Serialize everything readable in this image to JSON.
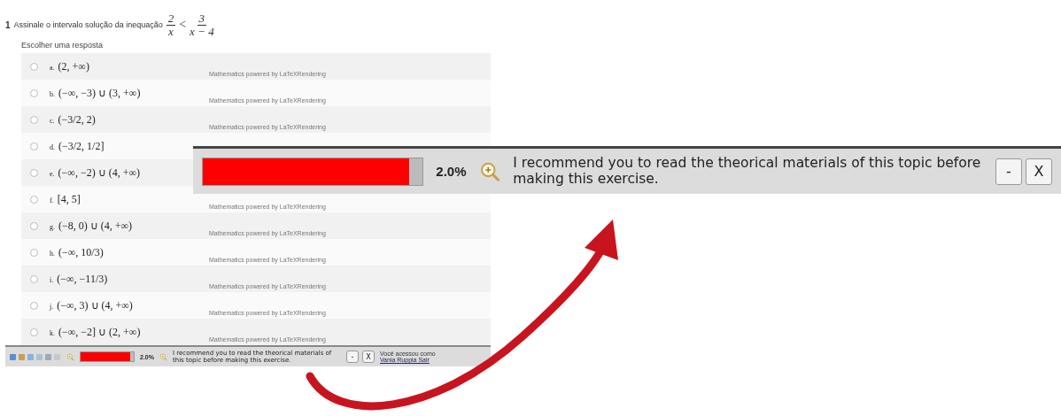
{
  "question": {
    "number": "1",
    "text": "Assinale o intervalo solução da inequação",
    "lhs": {
      "num": "2",
      "den": "x"
    },
    "op": "<",
    "rhs": {
      "num": "3",
      "den": "x − 4"
    },
    "prompt": "Escolher uma resposta"
  },
  "options": [
    {
      "letter": "a.",
      "answer": "(2, +∞)",
      "selected": false,
      "note": "Mathematics powered by LaTeXRendering"
    },
    {
      "letter": "b.",
      "answer": "(−∞, −3) ∪ (3, +∞)",
      "selected": false,
      "note": "Mathematics powered by LaTeXRendering"
    },
    {
      "letter": "c.",
      "answer": "(−3/2, 2)",
      "selected": false,
      "note": "Mathematics powered by LaTeXRendering"
    },
    {
      "letter": "d.",
      "answer": "(−3/2, 1/2]",
      "selected": false
    },
    {
      "letter": "e.",
      "answer": "(−∞, −2) ∪ (4, +∞)",
      "selected": false
    },
    {
      "letter": "f.",
      "answer": "[4, 5]",
      "selected": false,
      "note": "Mathematics powered by LaTeXRendering"
    },
    {
      "letter": "g.",
      "answer": "(−8, 0) ∪ (4, +∞)",
      "selected": false,
      "note": "Mathematics powered by LaTeXRendering"
    },
    {
      "letter": "h.",
      "answer": "(−∞, 10/3)",
      "selected": false,
      "note": "Mathematics powered by LaTeXRendering"
    },
    {
      "letter": "i.",
      "answer": "(−∞, −11/3)",
      "selected": false,
      "note": "Mathematics powered by LaTeXRendering"
    },
    {
      "letter": "j.",
      "answer": "(−∞, 3) ∪ (4, +∞)",
      "selected": false,
      "note": "Mathematics powered by LaTeXRendering"
    },
    {
      "letter": "k.",
      "answer": "(−∞, −2] ∪ (2, +∞)",
      "selected": false,
      "note": "Mathematics powered by LaTeXRendering"
    }
  ],
  "toolbar": {
    "level": 0.94,
    "percent": "2.0%",
    "message": "I recommend you to read the theorical materials of this topic before making this exercise.",
    "buttons": [
      "-",
      "X"
    ],
    "login_text": "Você acessou como",
    "login_link": "Vania Ruppia Sair"
  },
  "zoomed_toolbar": {
    "level": 0.94,
    "percent": "2.0%",
    "message": "I recommend you to read the theorical materials of this topic before making this exercise.",
    "buttons": [
      "-",
      "X"
    ]
  }
}
